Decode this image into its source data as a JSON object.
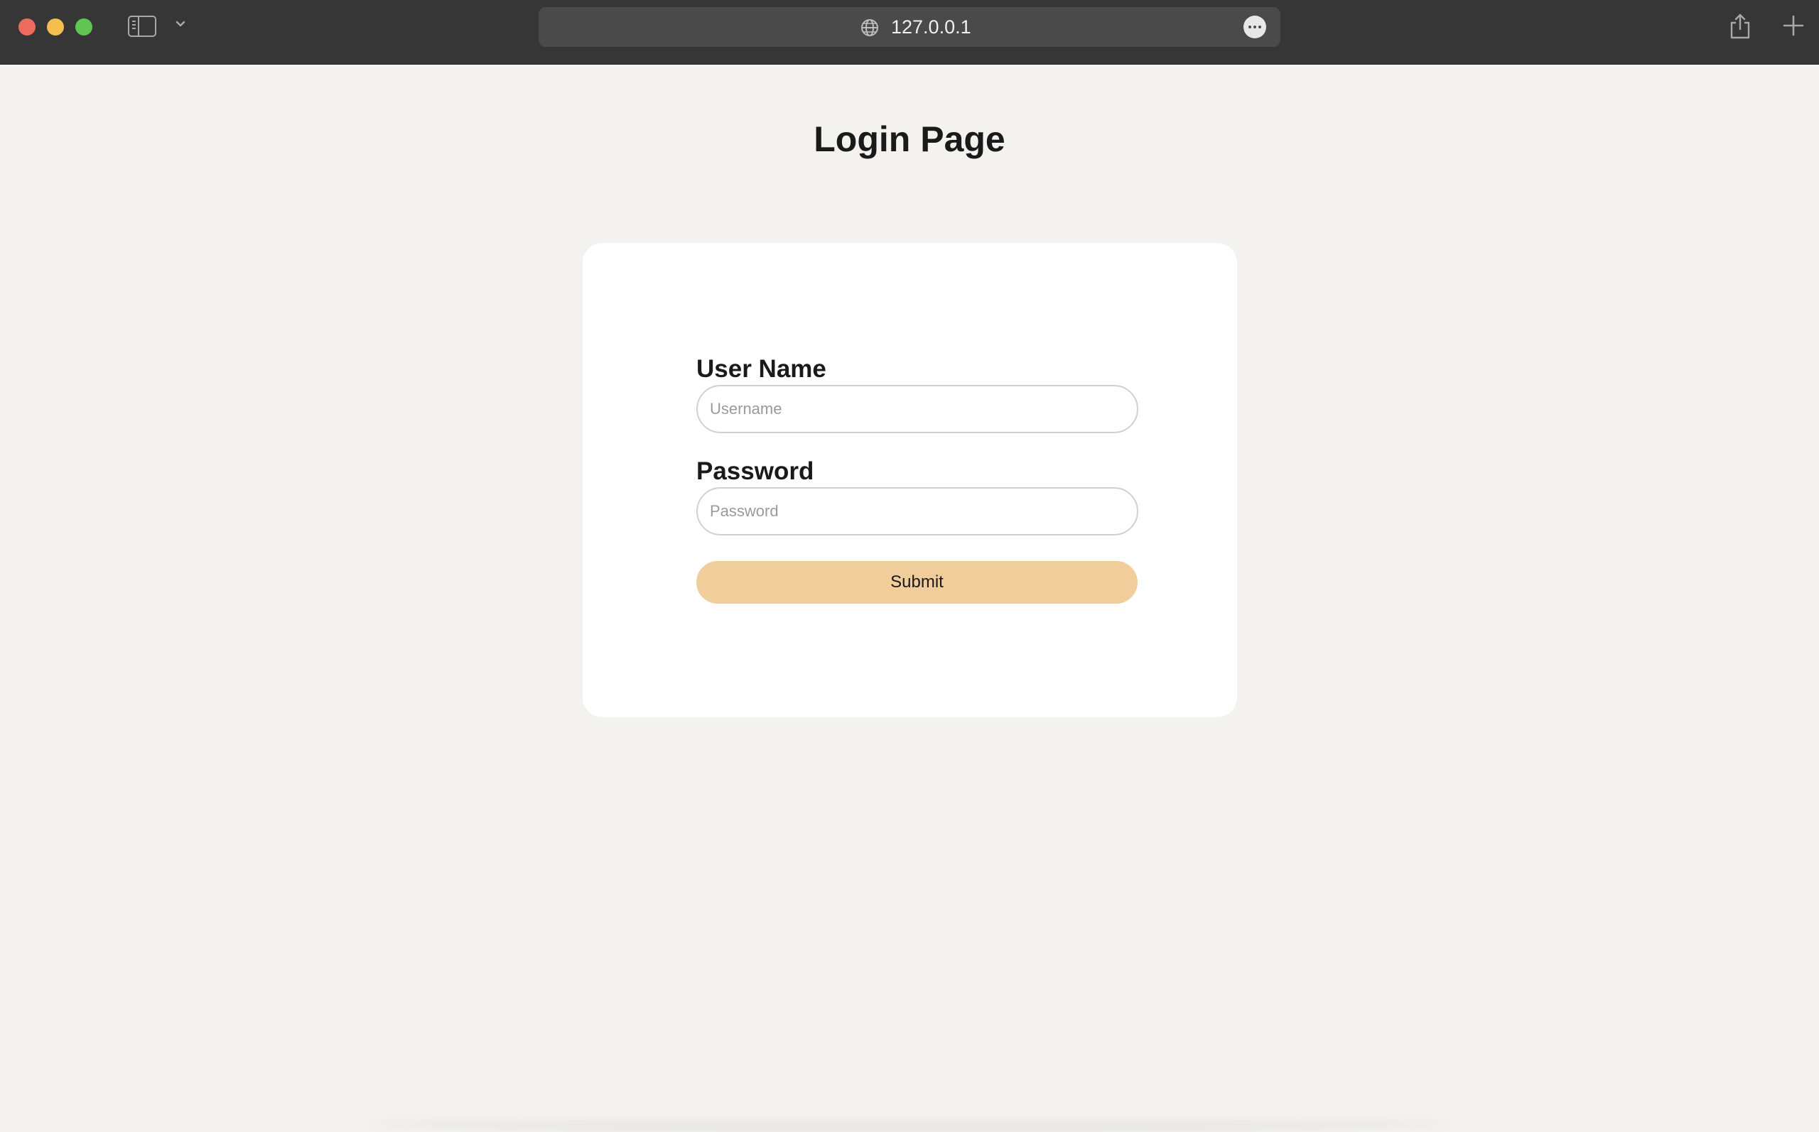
{
  "browser": {
    "url": "127.0.0.1",
    "icons": {
      "close": "close-window-icon",
      "minimize": "minimize-window-icon",
      "maximize": "maximize-window-icon",
      "sidebar": "sidebar-icon",
      "chevron": "chevron-down-icon",
      "globe": "globe-icon",
      "more": "more-options-icon",
      "share": "share-icon",
      "new_tab": "plus-icon"
    },
    "colors": {
      "toolbar": "#363636",
      "address_bar": "#4a4a4a",
      "close": "#ed6a5e",
      "minimize": "#f5bf4f",
      "maximize": "#61c554"
    }
  },
  "page": {
    "title": "Login Page",
    "background": "#f3f2ee"
  },
  "form": {
    "username_label": "User Name",
    "username_placeholder": "Username",
    "username_value": "",
    "password_label": "Password",
    "password_placeholder": "Password",
    "password_value": "",
    "submit_label": "Submit",
    "submit_color": "#f0cd9b"
  }
}
